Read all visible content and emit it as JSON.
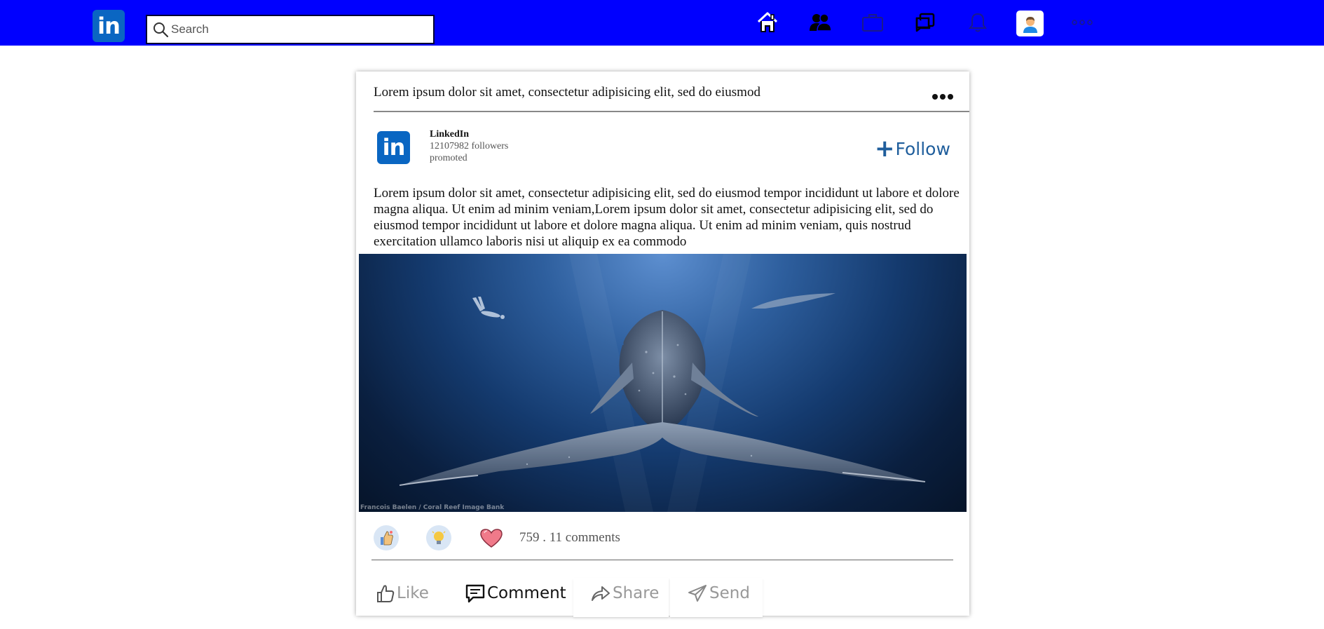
{
  "topbar": {
    "logo_text": "in",
    "search_placeholder": "Search",
    "nav_icons": [
      "home-icon",
      "network-icon",
      "jobs-icon",
      "messaging-icon",
      "notifications-icon",
      "profile-avatar",
      "more-icon"
    ]
  },
  "post": {
    "header_text": "Lorem ipsum dolor sit amet, consectetur adipisicing elit, sed do eiusmod",
    "author": {
      "logo_text": "in",
      "name": "LinkedIn",
      "followers": "12107982 followers",
      "tag": "promoted"
    },
    "follow_label": "Follow",
    "body": "Lorem ipsum dolor sit amet, consectetur adipisicing elit, sed do eiusmod tempor incididunt ut labore et dolore magna aliqua. Ut enim ad minim veniam,Lorem ipsum dolor sit amet, consectetur adipisicing elit, sed do eiusmod tempor incididunt ut labore et dolore magna aliqua. Ut enim ad minim veniam, quis nostrud exercitation ullamco laboris nisi ut aliquip ex ea commodo",
    "image_credit": "Francois Baelen / Coral Reef Image Bank",
    "reaction_summary": "759 . 11 comments",
    "actions": {
      "like": "Like",
      "comment": "Comment",
      "share": "Share",
      "send": "Send"
    }
  },
  "colors": {
    "topbar": "#0000ff",
    "brand": "#0a66c2",
    "follow": "#1f5e9c"
  }
}
